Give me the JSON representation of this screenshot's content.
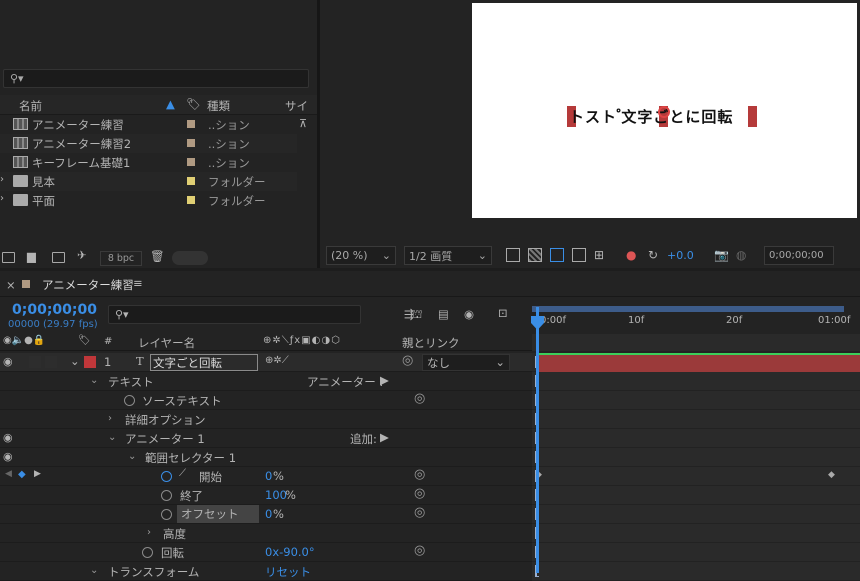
{
  "project": {
    "search_placeholder": "",
    "col_name": "名前",
    "col_type": "種類",
    "col_size": "サイズ",
    "items": [
      {
        "name": "アニメーター練習",
        "type": "..ション",
        "kind": "comp",
        "label_color": "#b09a82"
      },
      {
        "name": "アニメーター練習2",
        "type": "..ション",
        "kind": "comp",
        "label_color": "#b09a82"
      },
      {
        "name": "キーフレーム基礎1",
        "type": "..ション",
        "kind": "comp",
        "label_color": "#b09a82"
      },
      {
        "name": "見本",
        "type": "フォルダー",
        "kind": "folder",
        "label_color": "#e0cf74"
      },
      {
        "name": "平面",
        "type": "フォルダー",
        "kind": "folder",
        "label_color": "#e0cf74"
      }
    ],
    "bpc": "8 bpc"
  },
  "viewer": {
    "comp_text": "トスト ゚文字ごとに回転",
    "zoom": "(20 %)",
    "quality": "1/2 画質",
    "exposure": "+0.0",
    "timecode": "0;00;00;00"
  },
  "timeline": {
    "tab_title": "アニメーター練習",
    "timecode": "0;00;00;00",
    "frames": "00000 (29.97 fps)",
    "search_placeholder": "",
    "col_layer_name": "レイヤー名",
    "col_parent": "親とリンク",
    "ruler": {
      "t0": "0:00f",
      "t1": "10f",
      "t2": "20f",
      "t3": "01:00f"
    },
    "layer": {
      "num": "1",
      "type_icon": "T",
      "name": "文字ごと回転",
      "parent": "なし",
      "label_color": "#c0373a"
    },
    "props": {
      "text": "テキスト",
      "animator_menu": "アニメーター :",
      "source_text": "ソーステキスト",
      "more_options": "詳細オプション",
      "animator1": "アニメーター 1",
      "add": "追加:",
      "range_selector": "範囲セレクター 1",
      "start": "開始",
      "start_value": "0",
      "end": "終了",
      "end_value": "100",
      "offset": "オフセット",
      "offset_value": "0",
      "unit": "%",
      "advanced": "高度",
      "rotation": "回転",
      "rotation_value": "0x-90.0°",
      "transform": "トランスフォーム",
      "transform_value": "リセット"
    }
  },
  "colors": {
    "accent": "#3a8ee6",
    "track_bar": "#9b3a3a",
    "green": "#3ccf5a"
  }
}
